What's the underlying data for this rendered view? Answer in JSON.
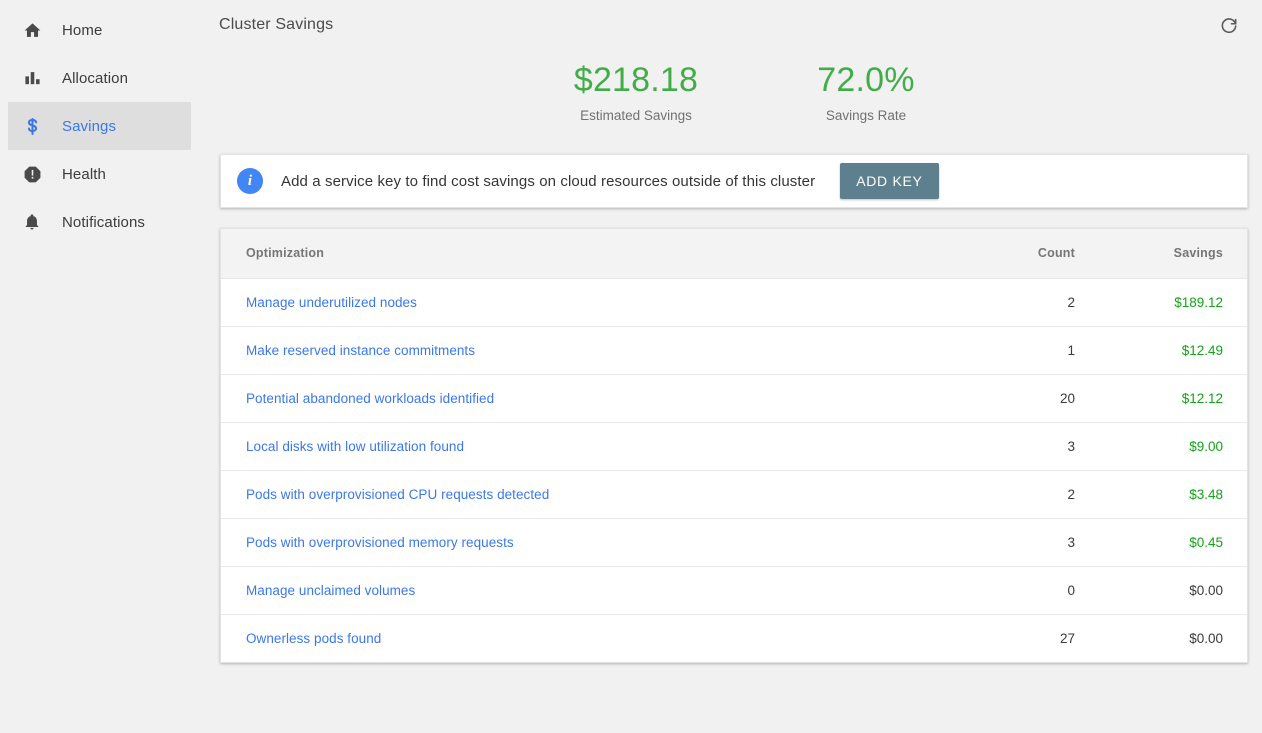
{
  "sidebar": {
    "items": [
      {
        "label": "Home",
        "icon": "home-icon",
        "active": false
      },
      {
        "label": "Allocation",
        "icon": "bar-chart-icon",
        "active": false
      },
      {
        "label": "Savings",
        "icon": "dollar-sign-icon",
        "active": true
      },
      {
        "label": "Health",
        "icon": "alert-octagon-icon",
        "active": false
      },
      {
        "label": "Notifications",
        "icon": "bell-icon",
        "active": false
      }
    ]
  },
  "header": {
    "title": "Cluster Savings",
    "refresh_icon": "refresh-icon"
  },
  "metrics": [
    {
      "value": "$218.18",
      "label": "Estimated Savings"
    },
    {
      "value": "72.0%",
      "label": "Savings Rate"
    }
  ],
  "banner": {
    "icon": "info-icon",
    "message": "Add a service key to find cost savings on cloud resources outside of this cluster",
    "button_label": "ADD KEY"
  },
  "table": {
    "columns": [
      "Optimization",
      "Count",
      "Savings"
    ],
    "rows": [
      {
        "optimization": "Manage underutilized nodes",
        "count": "2",
        "savings": "$189.12",
        "zero": false
      },
      {
        "optimization": "Make reserved instance commitments",
        "count": "1",
        "savings": "$12.49",
        "zero": false
      },
      {
        "optimization": "Potential abandoned workloads identified",
        "count": "20",
        "savings": "$12.12",
        "zero": false
      },
      {
        "optimization": "Local disks with low utilization found",
        "count": "3",
        "savings": "$9.00",
        "zero": false
      },
      {
        "optimization": "Pods with overprovisioned CPU requests detected",
        "count": "2",
        "savings": "$3.48",
        "zero": false
      },
      {
        "optimization": "Pods with overprovisioned memory requests",
        "count": "3",
        "savings": "$0.45",
        "zero": false
      },
      {
        "optimization": "Manage unclaimed volumes",
        "count": "0",
        "savings": "$0.00",
        "zero": true
      },
      {
        "optimization": "Ownerless pods found",
        "count": "27",
        "savings": "$0.00",
        "zero": true
      }
    ]
  },
  "colors": {
    "accent_blue": "#3b78e7",
    "green": "#41ad49",
    "savings_green": "#13a318",
    "button_slate": "#5e7f8e",
    "info_blue": "#4285f4",
    "background": "#f1f1f1"
  }
}
